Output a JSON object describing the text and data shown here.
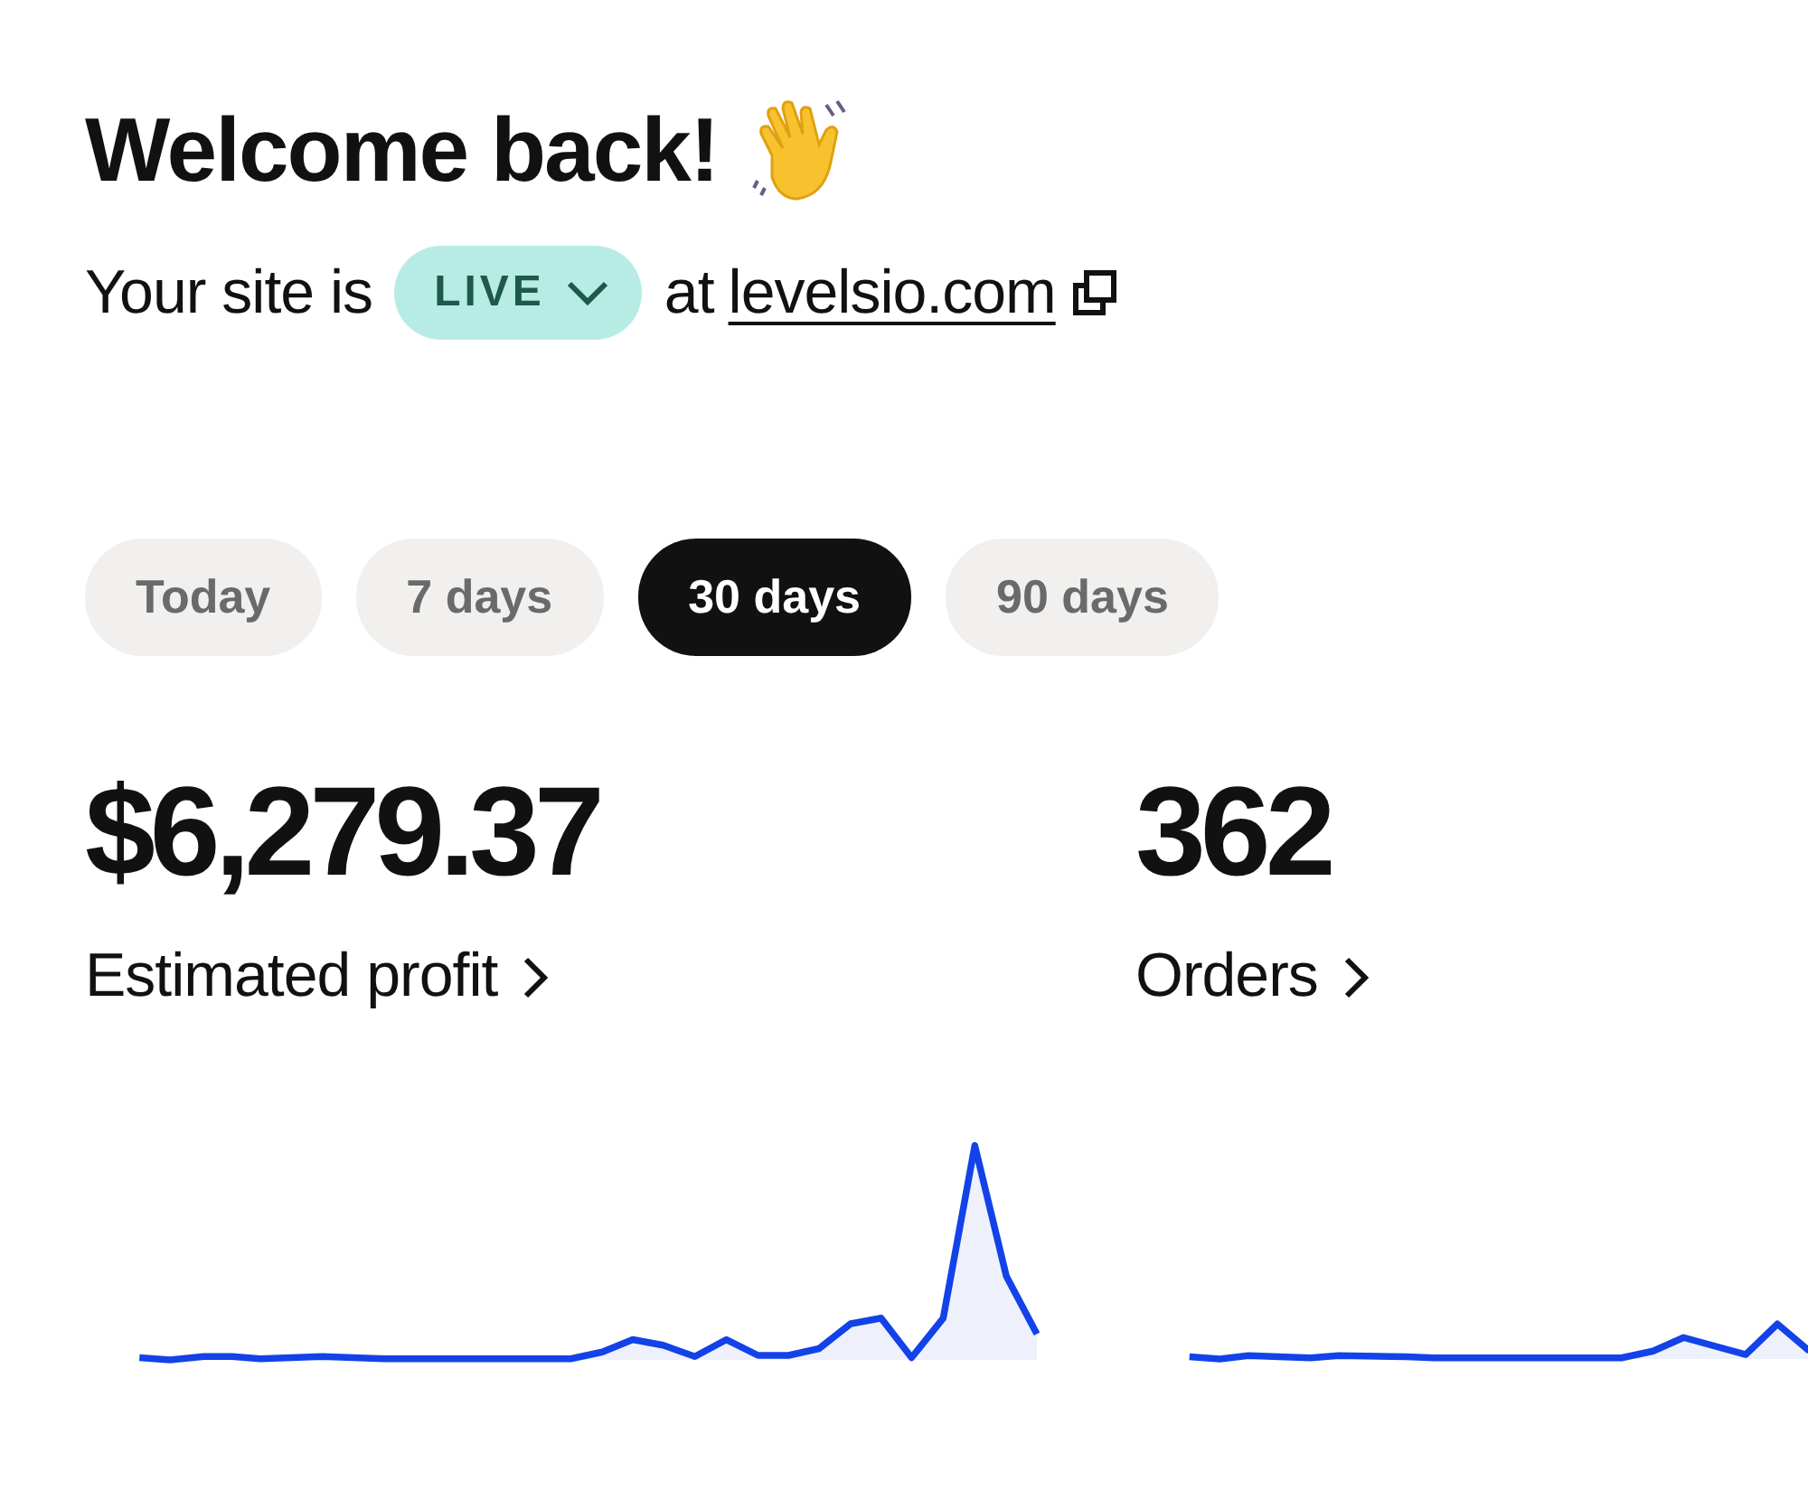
{
  "greeting": "Welcome back!",
  "site_status": {
    "prefix": "Your site is",
    "status": "LIVE",
    "connector": "at",
    "domain": "levelsio.com"
  },
  "tabs": [
    {
      "label": "Today",
      "selected": false
    },
    {
      "label": "7 days",
      "selected": false
    },
    {
      "label": "30 days",
      "selected": true
    },
    {
      "label": "90 days",
      "selected": false
    }
  ],
  "metrics": [
    {
      "value": "$6,279.37",
      "label": "Estimated profit"
    },
    {
      "value": "362",
      "label": "Orders"
    }
  ]
}
